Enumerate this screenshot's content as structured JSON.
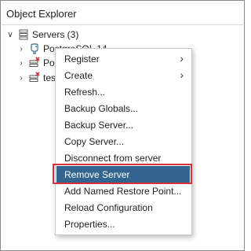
{
  "panel": {
    "title": "Object Explorer"
  },
  "tree": {
    "root_label": "Servers (3)",
    "children": [
      {
        "label": "PostgreSQL 14",
        "icon": "postgres-elephant-icon"
      },
      {
        "label": "Pos",
        "icon": "server-disconnected-icon"
      },
      {
        "label": "test",
        "icon": "server-disconnected-icon"
      }
    ]
  },
  "context_menu": {
    "items": [
      {
        "label": "Register",
        "submenu": true
      },
      {
        "label": "Create",
        "submenu": true
      },
      {
        "label": "Refresh..."
      },
      {
        "label": "Backup Globals..."
      },
      {
        "label": "Backup Server..."
      },
      {
        "label": "Copy Server..."
      },
      {
        "label": "Disconnect from server"
      },
      {
        "label": "Remove Server",
        "selected": true
      },
      {
        "label": "Add Named Restore Point..."
      },
      {
        "label": "Reload Configuration"
      },
      {
        "label": "Properties..."
      }
    ]
  },
  "colors": {
    "selected_bg": "#326690",
    "highlight_outline": "#d6303a"
  }
}
